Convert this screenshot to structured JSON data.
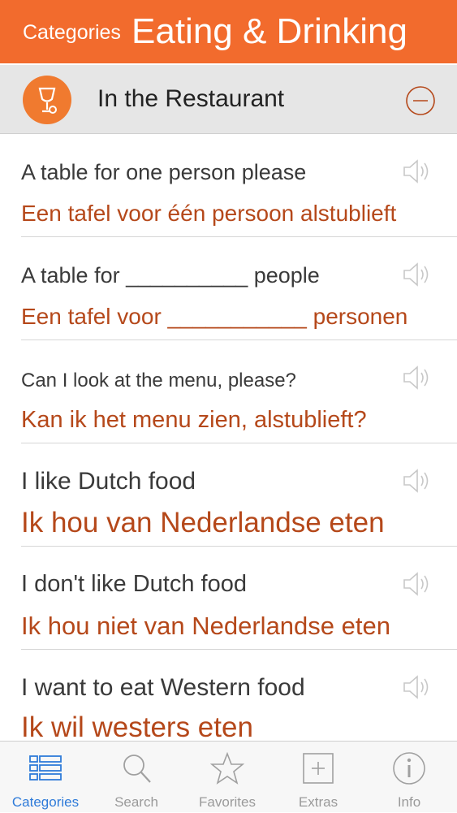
{
  "header": {
    "back_label": "Categories",
    "title": "Eating & Drinking"
  },
  "section": {
    "title": "In the Restaurant",
    "icon": "wine-glass-icon",
    "collapse_icon": "minus-circle-icon"
  },
  "phrases": [
    {
      "english": "A table for one person please",
      "dutch": "Een tafel voor één persoon alstublieft"
    },
    {
      "english": "A table for __________ people",
      "dutch": "Een tafel voor ___________ personen"
    },
    {
      "english": "Can I look at the menu, please?",
      "dutch": "Kan ik het menu zien, alstublieft?"
    },
    {
      "english": "I like Dutch food",
      "dutch": "Ik hou van Nederlandse eten"
    },
    {
      "english": "I don't like Dutch food",
      "dutch": "Ik hou niet van Nederlandse eten"
    },
    {
      "english": "I want to eat Western food",
      "dutch": "Ik wil westers eten"
    }
  ],
  "tabs": [
    {
      "label": "Categories",
      "icon": "list-grid-icon",
      "active": true
    },
    {
      "label": "Search",
      "icon": "magnifier-icon"
    },
    {
      "label": "Favorites",
      "icon": "star-icon"
    },
    {
      "label": "Extras",
      "icon": "plus-box-icon"
    },
    {
      "label": "Info",
      "icon": "info-circle-icon"
    }
  ],
  "colors": {
    "accent": "#f26b2d",
    "dutch_text": "#b5481a",
    "active_tab": "#2f7bd9"
  }
}
